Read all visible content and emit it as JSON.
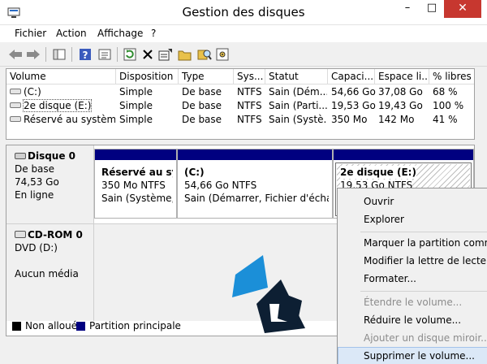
{
  "window": {
    "title": "Gestion des disques",
    "minimize": "–",
    "maximize": "□",
    "close": "✕"
  },
  "menu": [
    "Fichier",
    "Action",
    "Affichage",
    "?"
  ],
  "toolbar": [
    "back-icon",
    "forward-icon",
    "console-tree-icon",
    "help-icon",
    "properties-list-icon",
    "refresh-icon",
    "delete-icon",
    "properties-icon",
    "open-icon",
    "explore-icon",
    "rescan-icon"
  ],
  "volumes": {
    "headers": [
      "Volume",
      "Disposition",
      "Type",
      "Sys...",
      "Statut",
      "Capaci...",
      "Espace li...",
      "% libres"
    ],
    "rows": [
      [
        "(C:)",
        "Simple",
        "De base",
        "NTFS",
        "Sain (Dém...",
        "54,66 Go",
        "37,08 Go",
        "68 %"
      ],
      [
        "2e disque (E:)",
        "Simple",
        "De base",
        "NTFS",
        "Sain (Parti...",
        "19,53 Go",
        "19,43 Go",
        "100 %"
      ],
      [
        "Réservé au système",
        "Simple",
        "De base",
        "NTFS",
        "Sain (Systè...",
        "350 Mo",
        "142 Mo",
        "41 %"
      ]
    ]
  },
  "disk0": {
    "name": "Disque 0",
    "type": "De base",
    "size": "74,53 Go",
    "status": "En ligne",
    "partitions": [
      {
        "title": "Réservé au syst",
        "size": "350 Mo NTFS",
        "status": "Sain (Système, A"
      },
      {
        "title": "(C:)",
        "size": "54,66 Go NTFS",
        "status": "Sain (Démarrer, Fichier d'échange"
      },
      {
        "title": "2e disque  (E:)",
        "size": "19,53 Go NTFS",
        "status": ""
      }
    ]
  },
  "cdrom": {
    "name": "CD-ROM 0",
    "drive": "DVD (D:)",
    "media": "Aucun média"
  },
  "legend": {
    "unallocated": "Non alloué",
    "primary": "Partition principale"
  },
  "context_menu": [
    {
      "label": "Ouvrir",
      "state": "enabled"
    },
    {
      "label": "Explorer",
      "state": "enabled"
    },
    {
      "label": "Marquer la partition comme",
      "state": "enabled"
    },
    {
      "label": "Modifier la lettre de lecteur e",
      "state": "enabled"
    },
    {
      "label": "Formater...",
      "state": "enabled"
    },
    {
      "label": "Étendre le volume...",
      "state": "disabled"
    },
    {
      "label": "Réduire le volume...",
      "state": "enabled"
    },
    {
      "label": "Ajouter un disque miroir...",
      "state": "disabled"
    },
    {
      "label": "Supprimer le volume...",
      "state": "highlighted"
    }
  ],
  "colors": {
    "primary_partition": "#000080",
    "unallocated": "#000000",
    "logo_blue": "#1b8fd8",
    "logo_dark": "#0d1f33",
    "menu_highlight": "#dbe8f7",
    "close_button": "#c7372f"
  }
}
